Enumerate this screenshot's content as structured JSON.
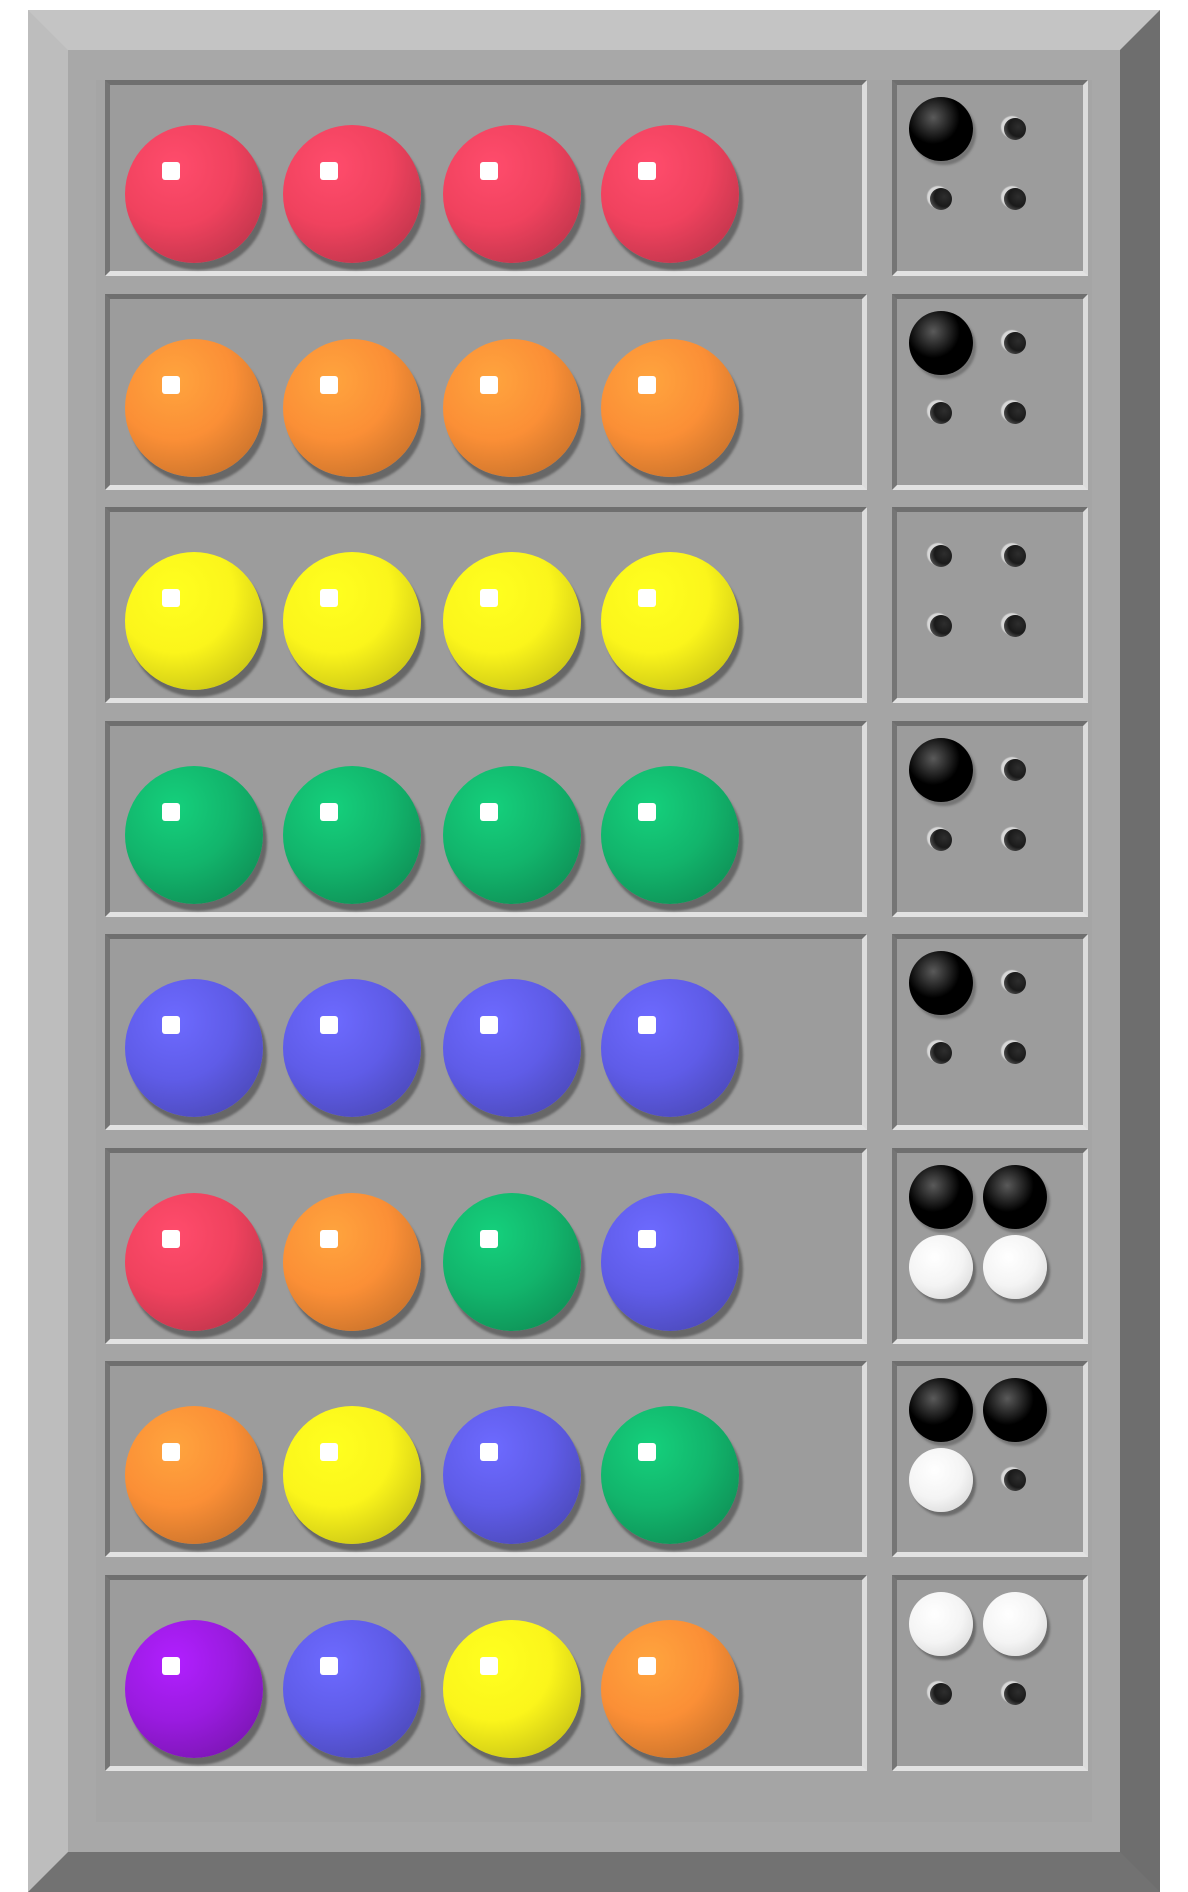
{
  "board": {
    "colors": {
      "red": "#f0425e",
      "orange": "#fb8f36",
      "yellow": "#fbf51b",
      "green": "#12b56c",
      "blue": "#5f5ce8",
      "purple": "#9a1be0",
      "key_black": "#000000",
      "key_white": "#ffffff"
    },
    "rows": [
      {
        "guess": [
          "red",
          "red",
          "red",
          "red"
        ],
        "feedback": [
          "black",
          "empty",
          "empty",
          "empty"
        ]
      },
      {
        "guess": [
          "orange",
          "orange",
          "orange",
          "orange"
        ],
        "feedback": [
          "black",
          "empty",
          "empty",
          "empty"
        ]
      },
      {
        "guess": [
          "yellow",
          "yellow",
          "yellow",
          "yellow"
        ],
        "feedback": [
          "empty",
          "empty",
          "empty",
          "empty"
        ]
      },
      {
        "guess": [
          "green",
          "green",
          "green",
          "green"
        ],
        "feedback": [
          "black",
          "empty",
          "empty",
          "empty"
        ]
      },
      {
        "guess": [
          "blue",
          "blue",
          "blue",
          "blue"
        ],
        "feedback": [
          "black",
          "empty",
          "empty",
          "empty"
        ]
      },
      {
        "guess": [
          "red",
          "orange",
          "green",
          "blue"
        ],
        "feedback": [
          "black",
          "black",
          "white",
          "white"
        ]
      },
      {
        "guess": [
          "orange",
          "yellow",
          "blue",
          "green"
        ],
        "feedback": [
          "black",
          "black",
          "white",
          "empty"
        ]
      },
      {
        "guess": [
          "purple",
          "blue",
          "yellow",
          "orange"
        ],
        "feedback": [
          "white",
          "white",
          "empty",
          "empty"
        ]
      }
    ]
  }
}
